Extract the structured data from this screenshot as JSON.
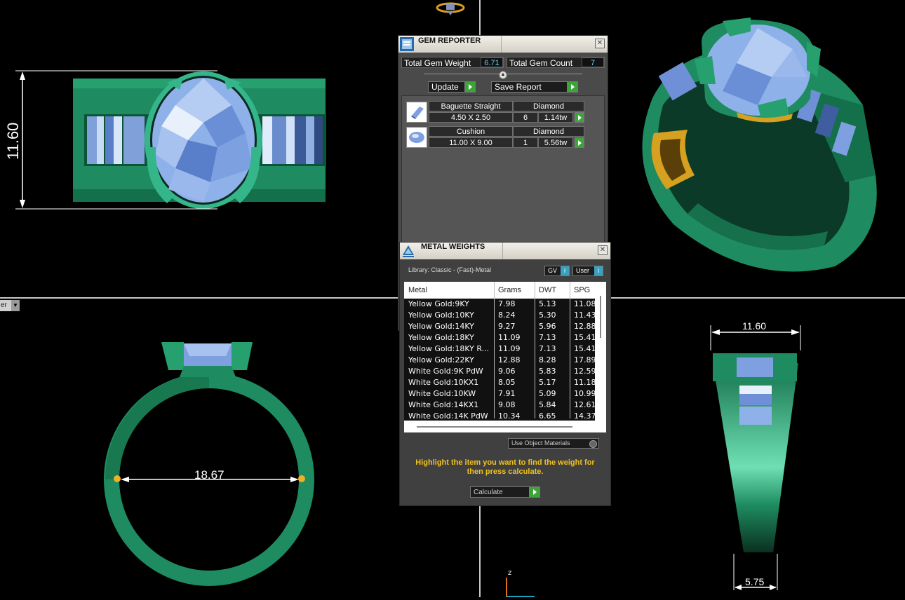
{
  "dimensions": {
    "top_left_height": "11.60",
    "bottom_left_inner": "18.67",
    "bottom_right_width": "11.60",
    "bottom_right_shank": "5.75"
  },
  "viewport": {
    "label": "er"
  },
  "axis": {
    "z_label": "z"
  },
  "gem_reporter": {
    "title": "GEM REPORTER",
    "total_gem_weight_label": "Total Gem Weight",
    "total_gem_weight_value": "6.71",
    "total_gem_count_label": "Total Gem Count",
    "total_gem_count_value": "7",
    "update_label": "Update",
    "save_report_label": "Save Report",
    "gems": [
      {
        "shape": "Baguette Straight",
        "material": "Diamond",
        "size": "4.50 X 2.50",
        "count": "6",
        "weight": "1.14tw"
      },
      {
        "shape": "Cushion",
        "material": "Diamond",
        "size": "11.00 X 9.00",
        "count": "1",
        "weight": "5.56tw"
      }
    ]
  },
  "metal_weights": {
    "title": "METAL WEIGHTS",
    "library_label": "Library: Classic - (Fast)-Metal",
    "gv_label": "GV",
    "user_label": "User",
    "columns": [
      "Metal",
      "Grams",
      "DWT",
      "SPG"
    ],
    "rows": [
      [
        "Yellow Gold:9KY",
        "7.98",
        "5.13",
        "11.08"
      ],
      [
        "Yellow Gold:10KY",
        "8.24",
        "5.30",
        "11.43"
      ],
      [
        "Yellow Gold:14KY",
        "9.27",
        "5.96",
        "12.88"
      ],
      [
        "Yellow Gold:18KY",
        "11.09",
        "7.13",
        "15.41"
      ],
      [
        "Yellow Gold:18KY R...",
        "11.09",
        "7.13",
        "15.41"
      ],
      [
        "Yellow Gold:22KY",
        "12.88",
        "8.28",
        "17.89"
      ],
      [
        "White Gold:9K PdW",
        "9.06",
        "5.83",
        "12.59"
      ],
      [
        "White Gold:10KX1",
        "8.05",
        "5.17",
        "11.18"
      ],
      [
        "White Gold:10KW",
        "7.91",
        "5.09",
        "10.99"
      ],
      [
        "White Gold:14KX1",
        "9.08",
        "5.84",
        "12.61"
      ],
      [
        "White Gold:14K PdW",
        "10.34",
        "6.65",
        "14.37"
      ]
    ],
    "use_object_materials_label": "Use Object Materials",
    "hint": "Highlight the item you want to find the weight for then press calculate.",
    "calculate_label": "Calculate"
  }
}
